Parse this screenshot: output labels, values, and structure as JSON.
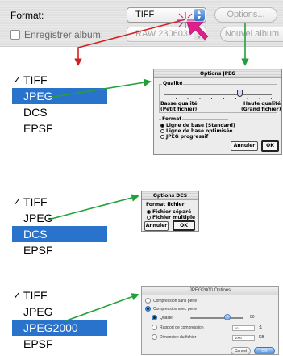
{
  "top": {
    "format_label": "Format:",
    "format_value": "TIFF",
    "options_label": "Options...",
    "album_checkbox_label": "Enregistrer album:",
    "album_value": "RAW 230603",
    "new_album_label": "Nouvel album"
  },
  "menus": [
    {
      "items": [
        "TIFF",
        "JPEG",
        "DCS",
        "EPSF"
      ],
      "checked": "TIFF",
      "selected": "JPEG"
    },
    {
      "items": [
        "TIFF",
        "JPEG",
        "DCS",
        "EPSF"
      ],
      "checked": "TIFF",
      "selected": "DCS"
    },
    {
      "items": [
        "TIFF",
        "JPEG",
        "JPEG2000",
        "EPSF"
      ],
      "checked": "TIFF",
      "selected": "JPEG2000"
    }
  ],
  "jpeg_dialog": {
    "title": "Options JPEG",
    "quality_label": "Qualité",
    "low_quality": "Basse qualité",
    "small_file": "(Petit fichier)",
    "high_quality": "Haute qualité",
    "large_file": "(Grand fichier)",
    "format_label": "Format",
    "opt_standard": "Ligne de base (Standard)",
    "opt_optimized": "Ligne de base optimisée",
    "opt_progressive": "JPEG progressif",
    "cancel": "Annuler",
    "ok": "OK"
  },
  "dcs_dialog": {
    "title": "Options DCS",
    "file_format_label": "Format fichier",
    "opt_separate": "Fichier séparé",
    "opt_multiple": "Fichier multiple",
    "cancel": "Annuler",
    "ok": "OK"
  },
  "jp2_dialog": {
    "title": "JPEG2000 Options",
    "opt_lossless": "Compression sans perte",
    "opt_lossy": "Compression avec perte",
    "quality_label": "Qualité",
    "quality_value": "80",
    "ratio_label": "Rapport de compression",
    "ratio_value": "10",
    "ratio_unit": ":1",
    "size_label": "Dimension du fichier",
    "size_value": "1000",
    "size_unit": "KB",
    "cancel": "Cancel",
    "ok": "OK"
  },
  "colors": {
    "selection": "#2a73cc",
    "arrow_red": "#d42020",
    "arrow_green": "#22a03a",
    "cursor_pink": "#e0208a"
  }
}
